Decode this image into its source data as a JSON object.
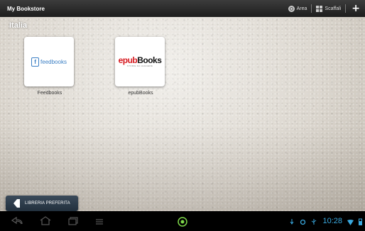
{
  "app": {
    "title": "My Bookstore"
  },
  "actionbar": {
    "area_label": "Area",
    "shelf_label": "Scaffali",
    "add_icon": "plus-icon"
  },
  "section": {
    "label": "Italia"
  },
  "stores": [
    {
      "name": "Feedbooks",
      "logo_text": "feedbooks"
    },
    {
      "name": "epubBooks",
      "logo_epub": "epub",
      "logo_books": "Books",
      "logo_tagline": "STORIE DA LEGGERE"
    }
  ],
  "favorite_button": {
    "label": "LIBRERIA PREFERITA",
    "icon": "bookmark-icon"
  },
  "status_bar": {
    "time": "10:28",
    "accent": "#3aa9df"
  }
}
